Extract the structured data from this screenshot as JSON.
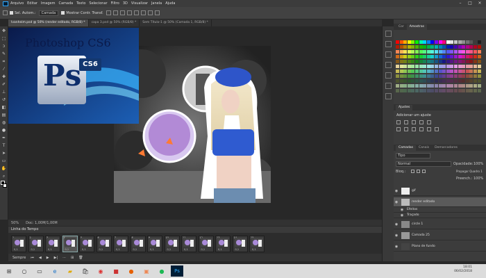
{
  "menu": {
    "items": [
      "Arquivo",
      "Editar",
      "Imagem",
      "Camada",
      "Texto",
      "Selecionar",
      "Filtro",
      "3D",
      "Visualizar",
      "Janela",
      "Ajuda"
    ]
  },
  "options": {
    "auto_select": "Sel. Autom.:",
    "target": "Camada",
    "transform": "Mostrar Contr. Transf."
  },
  "tabs": [
    "Ivanheim.psd @ 50% (render editado, RGB/8) *",
    "capa 3.psd @ 50% (RGB/8) *",
    "Sem Título-1 @ 50% (Camada 1, RGB/8) *"
  ],
  "overlay": {
    "title": "Photoshop CS6",
    "badge": "CS6",
    "logo": "Ps"
  },
  "status": {
    "zoom": "50%",
    "doc": "Doc: 1,00M/1,00M"
  },
  "timeline": {
    "title": "Linha do Tempo",
    "frames": [
      {
        "num": "1",
        "dur": "0,1"
      },
      {
        "num": "2",
        "dur": "0,1"
      },
      {
        "num": "3",
        "dur": "0,1"
      },
      {
        "num": "4",
        "dur": "0,1"
      },
      {
        "num": "5",
        "dur": "0,1"
      },
      {
        "num": "6",
        "dur": "0,1"
      },
      {
        "num": "7",
        "dur": "0,1"
      },
      {
        "num": "8",
        "dur": "0,1"
      },
      {
        "num": "9",
        "dur": "0,1"
      },
      {
        "num": "10",
        "dur": "0,1"
      },
      {
        "num": "11",
        "dur": "0,1"
      },
      {
        "num": "12",
        "dur": "0,1"
      },
      {
        "num": "13",
        "dur": "0,1"
      },
      {
        "num": "14",
        "dur": "0,1"
      },
      {
        "num": "15",
        "dur": "0,1"
      }
    ],
    "loop": "Sempre"
  },
  "panels": {
    "color_tabs": [
      "Cor",
      "Amostras"
    ],
    "adjust_tab": "Ajustes",
    "adjust_title": "Adicionar um ajuste",
    "layer_tabs": [
      "Camadas",
      "Canais",
      "Demarcadores"
    ],
    "kind": "Tipo",
    "blend": "Normal",
    "opacity_label": "Opacidade:",
    "opacity": "100%",
    "lock": "Bloq.:",
    "propagate": "Propagar Quadro 1",
    "fill_label": "Preench.:",
    "fill": "100%",
    "layers": [
      "gif",
      "render editado",
      "Efeitos",
      "Traçado",
      "circle 1",
      "Camada 25",
      "Plano de fundo"
    ]
  },
  "taskbar": {
    "time": "18:01",
    "date": "06/02/2018"
  },
  "colors": {
    "accent": "#31a8ff"
  }
}
